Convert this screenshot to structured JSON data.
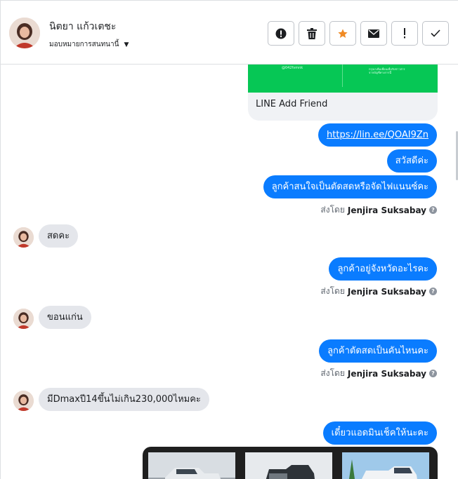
{
  "header": {
    "contact_name": "นิตยา แก้วเตชะ",
    "assign_label": "มอบหมายการสนทนานี้",
    "actions": [
      {
        "name": "spam-button",
        "icon": "alert-circle-icon"
      },
      {
        "name": "delete-button",
        "icon": "trash-icon"
      },
      {
        "name": "star-button",
        "icon": "star-icon"
      },
      {
        "name": "mark-unread-button",
        "icon": "envelope-icon"
      },
      {
        "name": "follow-up-button",
        "icon": "exclamation-icon"
      },
      {
        "name": "mark-done-button",
        "icon": "check-icon"
      }
    ]
  },
  "card": {
    "title": "LINE Add Friend",
    "banner_text_left": "@042fvmnk",
    "banner_text_right_1": "กรุณาเพิ่มเพื่อนเพื่อรับข่าวสาร",
    "banner_text_right_2": "จากบัญชีทางการนี้"
  },
  "messages": {
    "out_link": "https://lin.ee/QOAI9Zn",
    "out_1": "สวัสดีค่ะ",
    "out_2": "ลูกค้าสนใจเป็นตัดสดหรือจัดไฟแนนซ์คะ",
    "sent_by_prefix": "ส่งโดย",
    "sent_by_name": "Jenjira Suksabay",
    "in_1": "สดคะ",
    "out_3": "ลูกค้าอยู่จังหวัดอะไรคะ",
    "in_2": "ขอนแก่น",
    "out_4": "ลูกค้าตัดสดเป็นคันไหนคะ",
    "in_3": "มีDmaxปี14ขึ้นไม่เกิน230,000ไหมคะ",
    "out_5": "เดี๋ยวแอดมินเช็คให้นะคะ"
  },
  "colors": {
    "outgoing_bubble": "#0a7cff",
    "incoming_bubble": "#e4e6eb",
    "line_green": "#06c755",
    "star": "#f08a24"
  }
}
